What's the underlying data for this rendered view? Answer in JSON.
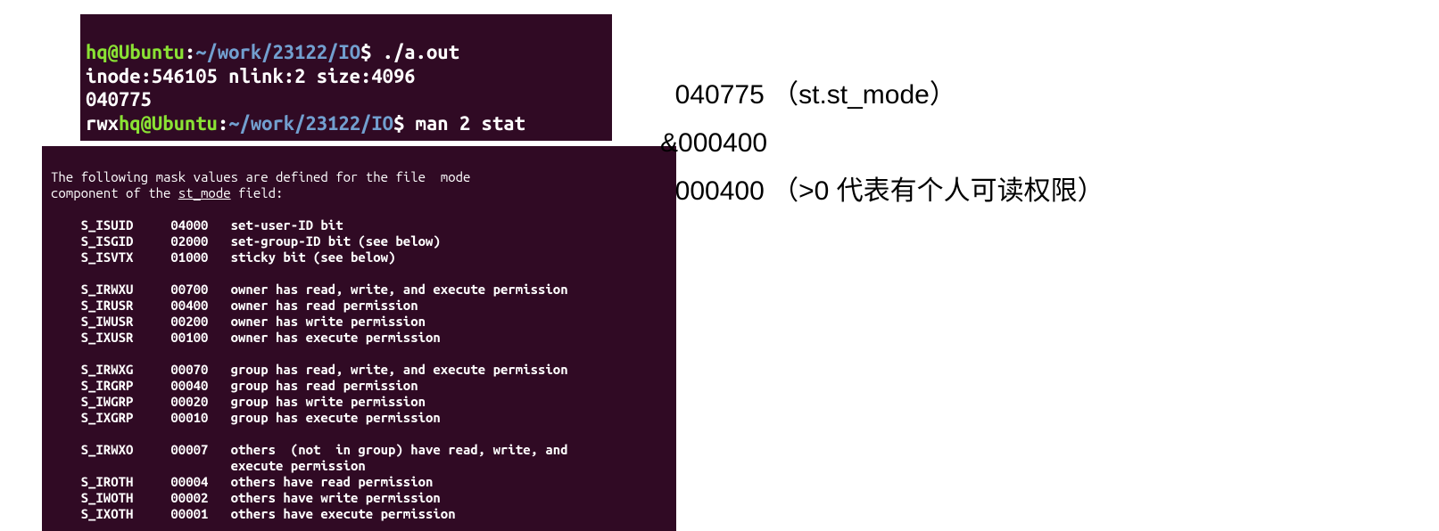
{
  "term1": {
    "prompt1_user": "hq@Ubuntu",
    "prompt1_path": "~/work/23122/IO",
    "cmd1": "./a.out",
    "out_line1": "inode:546105 nlink:2 size:4096",
    "out_line2": "040775",
    "out_line3_prefix": "rwx",
    "prompt2_user": "hq@Ubuntu",
    "prompt2_path": "~/work/23122/IO",
    "cmd2": "man 2 stat"
  },
  "man": {
    "intro_line1": "The following mask values are defined for the file  mode",
    "intro_line2a": "component of the ",
    "intro_line2b": "st_mode",
    "intro_line2c": " field:",
    "rows": {
      "r0": "    S_ISUID     04000   set-user-ID bit",
      "r1": "    S_ISGID     02000   set-group-ID bit (see below)",
      "r2": "    S_ISVTX     01000   sticky bit (see below)",
      "r3": "",
      "r4": "    S_IRWXU     00700   owner has read, write, and execute permission",
      "r5": "    S_IRUSR     00400   owner has read permission",
      "r6": "    S_IWUSR     00200   owner has write permission",
      "r7": "    S_IXUSR     00100   owner has execute permission",
      "r8": "",
      "r9": "    S_IRWXG     00070   group has read, write, and execute permission",
      "r10": "    S_IRGRP     00040   group has read permission",
      "r11": "    S_IWGRP     00020   group has write permission",
      "r12": "    S_IXGRP     00010   group has execute permission",
      "r13": "",
      "r14": "    S_IRWXO     00007   others  (not  in group) have read, write, and",
      "r15": "                        execute permission",
      "r16": "    S_IROTH     00004   others have read permission",
      "r17": "    S_IWOTH     00002   others have write permission",
      "r18": "    S_IXOTH     00001   others have execute permission"
    }
  },
  "annotation": {
    "line1": "  040775 （st.st_mode）",
    "line2": "&000400",
    "line3": "  000400 （>0 代表有个人可读权限）"
  }
}
